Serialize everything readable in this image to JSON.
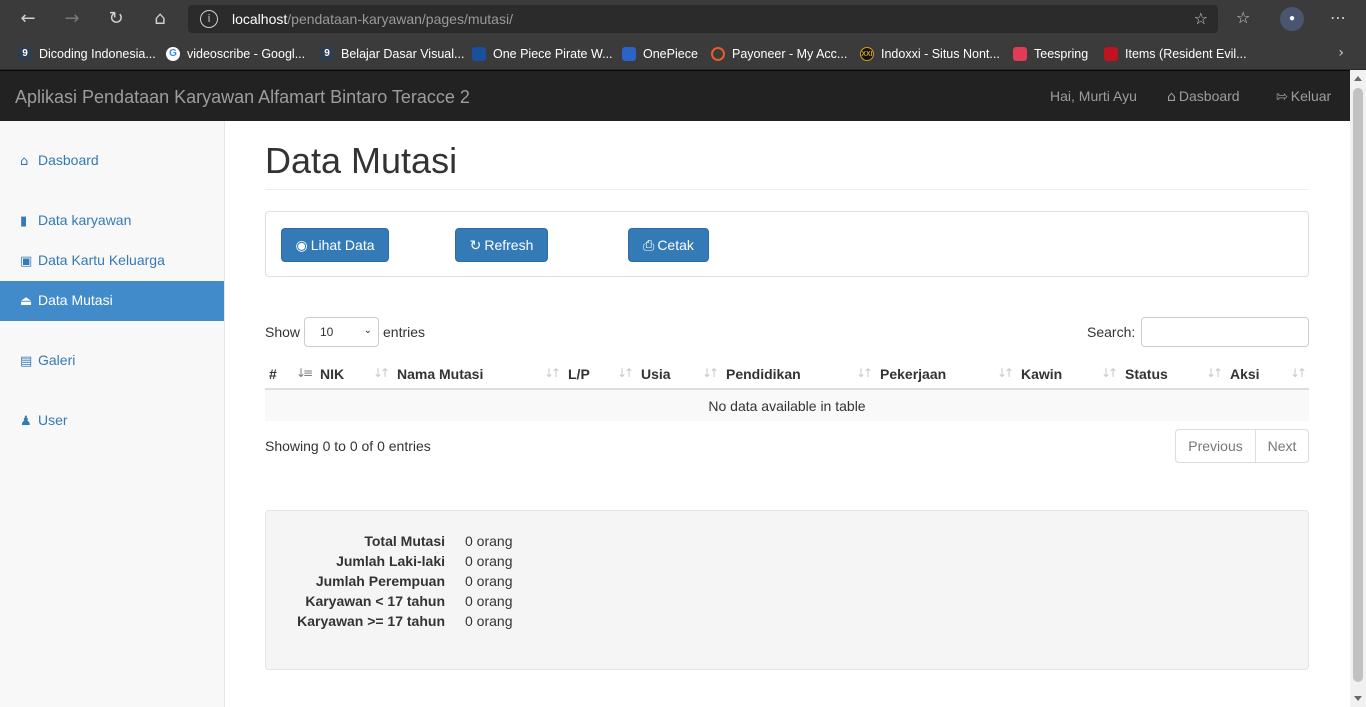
{
  "browser": {
    "url_host": "localhost",
    "url_path": "/pendataan-karyawan/pages/mutasi/",
    "bookmarks": [
      {
        "label": "Dicoding Indonesia...",
        "icon": "dicoding-icon",
        "color": "#2d3e50"
      },
      {
        "label": "videoscribe - Googl...",
        "icon": "google-icon",
        "color": "#ffffff"
      },
      {
        "label": "Belajar Dasar Visual...",
        "icon": "dicoding-icon",
        "color": "#2d3e50"
      },
      {
        "label": "One Piece Pirate W...",
        "icon": "onepiece-icon",
        "color": "#1a4fa0"
      },
      {
        "label": "OnePiece",
        "icon": "shield-icon",
        "color": "#2b63c9"
      },
      {
        "label": "Payoneer - My Acc...",
        "icon": "payoneer-icon",
        "color": "#e85c2b"
      },
      {
        "label": "Indoxxi - Situs Nont...",
        "icon": "indoxxi-icon",
        "color": "#111111"
      },
      {
        "label": "Teespring",
        "icon": "teespring-icon",
        "color": "#e23b57"
      },
      {
        "label": "Items (Resident Evil...",
        "icon": "resident-evil-icon",
        "color": "#c1121f"
      }
    ]
  },
  "navbar": {
    "brand": "Aplikasi Pendataan Karyawan Alfamart Bintaro Teracce 2",
    "greeting": "Hai, Murti Ayu",
    "dashboard_label": "Dasboard",
    "logout_label": "Keluar"
  },
  "sidebar": {
    "items": [
      {
        "label": "Dasboard",
        "icon": "home-icon"
      },
      {
        "label": "Data karyawan",
        "icon": "book-icon"
      },
      {
        "label": "Data Kartu Keluarga",
        "icon": "inbox-icon"
      },
      {
        "label": "Data Mutasi",
        "icon": "eject-icon",
        "active": true
      },
      {
        "label": "Galeri",
        "icon": "picture-icon"
      },
      {
        "label": "User",
        "icon": "user-icon"
      }
    ]
  },
  "page": {
    "title": "Data Mutasi"
  },
  "toolbar": {
    "view_label": "Lihat Data",
    "refresh_label": "Refresh",
    "print_label": "Cetak"
  },
  "table": {
    "show_label": "Show",
    "page_size": "10",
    "entries_label": "entries",
    "search_label": "Search:",
    "columns": [
      "#",
      "NIK",
      "Nama Mutasi",
      "L/P",
      "Usia",
      "Pendidikan",
      "Pekerjaan",
      "Kawin",
      "Status",
      "Aksi"
    ],
    "empty_message": "No data available in table",
    "info": "Showing 0 to 0 of 0 entries",
    "previous_label": "Previous",
    "next_label": "Next"
  },
  "summary": [
    {
      "label": "Total Mutasi",
      "value": "0 orang"
    },
    {
      "label": "Jumlah Laki-laki",
      "value": "0 orang"
    },
    {
      "label": "Jumlah Perempuan",
      "value": "0 orang"
    },
    {
      "label": "Karyawan < 17 tahun",
      "value": "0 orang"
    },
    {
      "label": "Karyawan >= 17 tahun",
      "value": "0 orang"
    }
  ],
  "colors": {
    "primary": "#337ab7",
    "active_sidebar": "#428bca",
    "navbar": "#222222"
  }
}
